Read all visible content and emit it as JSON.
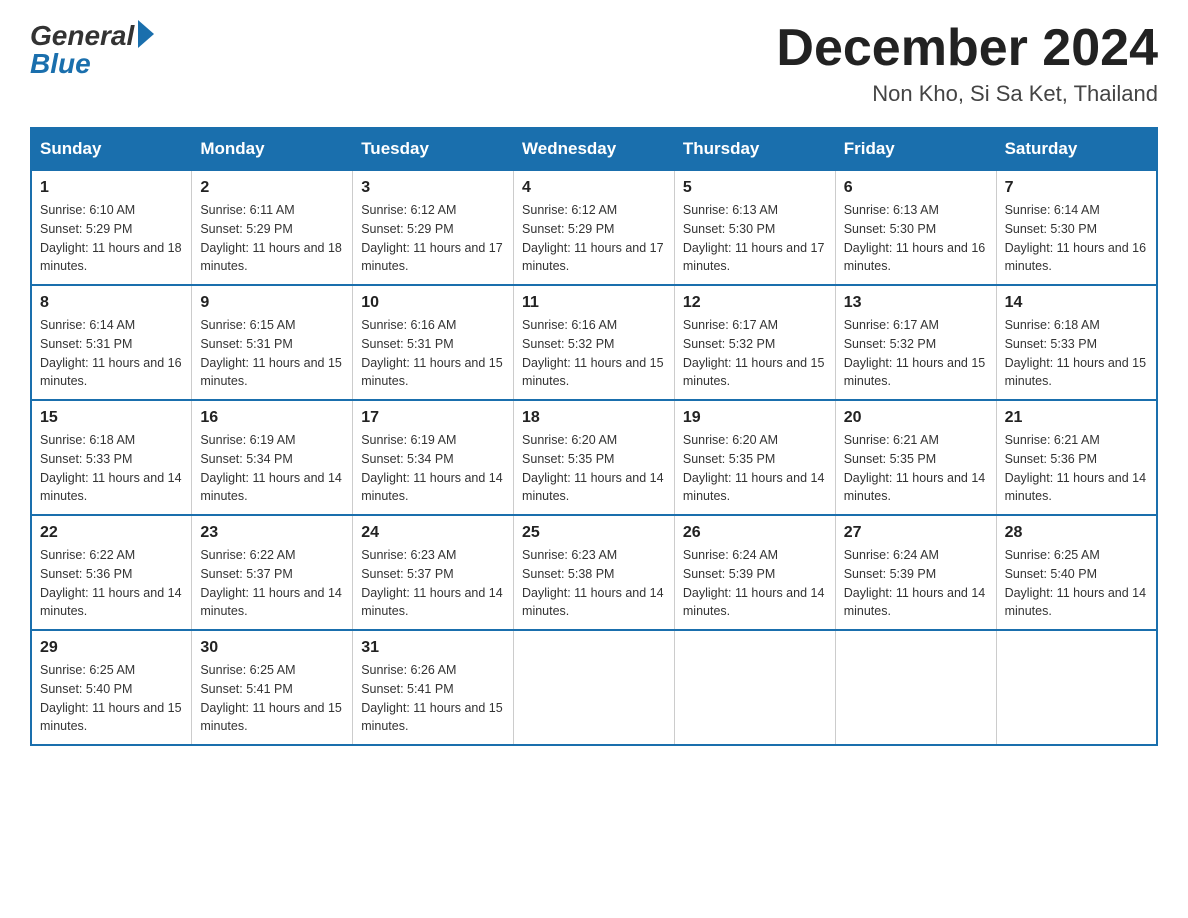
{
  "logo": {
    "general": "General",
    "blue": "Blue"
  },
  "title": "December 2024",
  "location": "Non Kho, Si Sa Ket, Thailand",
  "days_of_week": [
    "Sunday",
    "Monday",
    "Tuesday",
    "Wednesday",
    "Thursday",
    "Friday",
    "Saturday"
  ],
  "weeks": [
    [
      {
        "day": "1",
        "sunrise": "6:10 AM",
        "sunset": "5:29 PM",
        "daylight": "11 hours and 18 minutes."
      },
      {
        "day": "2",
        "sunrise": "6:11 AM",
        "sunset": "5:29 PM",
        "daylight": "11 hours and 18 minutes."
      },
      {
        "day": "3",
        "sunrise": "6:12 AM",
        "sunset": "5:29 PM",
        "daylight": "11 hours and 17 minutes."
      },
      {
        "day": "4",
        "sunrise": "6:12 AM",
        "sunset": "5:29 PM",
        "daylight": "11 hours and 17 minutes."
      },
      {
        "day": "5",
        "sunrise": "6:13 AM",
        "sunset": "5:30 PM",
        "daylight": "11 hours and 17 minutes."
      },
      {
        "day": "6",
        "sunrise": "6:13 AM",
        "sunset": "5:30 PM",
        "daylight": "11 hours and 16 minutes."
      },
      {
        "day": "7",
        "sunrise": "6:14 AM",
        "sunset": "5:30 PM",
        "daylight": "11 hours and 16 minutes."
      }
    ],
    [
      {
        "day": "8",
        "sunrise": "6:14 AM",
        "sunset": "5:31 PM",
        "daylight": "11 hours and 16 minutes."
      },
      {
        "day": "9",
        "sunrise": "6:15 AM",
        "sunset": "5:31 PM",
        "daylight": "11 hours and 15 minutes."
      },
      {
        "day": "10",
        "sunrise": "6:16 AM",
        "sunset": "5:31 PM",
        "daylight": "11 hours and 15 minutes."
      },
      {
        "day": "11",
        "sunrise": "6:16 AM",
        "sunset": "5:32 PM",
        "daylight": "11 hours and 15 minutes."
      },
      {
        "day": "12",
        "sunrise": "6:17 AM",
        "sunset": "5:32 PM",
        "daylight": "11 hours and 15 minutes."
      },
      {
        "day": "13",
        "sunrise": "6:17 AM",
        "sunset": "5:32 PM",
        "daylight": "11 hours and 15 minutes."
      },
      {
        "day": "14",
        "sunrise": "6:18 AM",
        "sunset": "5:33 PM",
        "daylight": "11 hours and 15 minutes."
      }
    ],
    [
      {
        "day": "15",
        "sunrise": "6:18 AM",
        "sunset": "5:33 PM",
        "daylight": "11 hours and 14 minutes."
      },
      {
        "day": "16",
        "sunrise": "6:19 AM",
        "sunset": "5:34 PM",
        "daylight": "11 hours and 14 minutes."
      },
      {
        "day": "17",
        "sunrise": "6:19 AM",
        "sunset": "5:34 PM",
        "daylight": "11 hours and 14 minutes."
      },
      {
        "day": "18",
        "sunrise": "6:20 AM",
        "sunset": "5:35 PM",
        "daylight": "11 hours and 14 minutes."
      },
      {
        "day": "19",
        "sunrise": "6:20 AM",
        "sunset": "5:35 PM",
        "daylight": "11 hours and 14 minutes."
      },
      {
        "day": "20",
        "sunrise": "6:21 AM",
        "sunset": "5:35 PM",
        "daylight": "11 hours and 14 minutes."
      },
      {
        "day": "21",
        "sunrise": "6:21 AM",
        "sunset": "5:36 PM",
        "daylight": "11 hours and 14 minutes."
      }
    ],
    [
      {
        "day": "22",
        "sunrise": "6:22 AM",
        "sunset": "5:36 PM",
        "daylight": "11 hours and 14 minutes."
      },
      {
        "day": "23",
        "sunrise": "6:22 AM",
        "sunset": "5:37 PM",
        "daylight": "11 hours and 14 minutes."
      },
      {
        "day": "24",
        "sunrise": "6:23 AM",
        "sunset": "5:37 PM",
        "daylight": "11 hours and 14 minutes."
      },
      {
        "day": "25",
        "sunrise": "6:23 AM",
        "sunset": "5:38 PM",
        "daylight": "11 hours and 14 minutes."
      },
      {
        "day": "26",
        "sunrise": "6:24 AM",
        "sunset": "5:39 PM",
        "daylight": "11 hours and 14 minutes."
      },
      {
        "day": "27",
        "sunrise": "6:24 AM",
        "sunset": "5:39 PM",
        "daylight": "11 hours and 14 minutes."
      },
      {
        "day": "28",
        "sunrise": "6:25 AM",
        "sunset": "5:40 PM",
        "daylight": "11 hours and 14 minutes."
      }
    ],
    [
      {
        "day": "29",
        "sunrise": "6:25 AM",
        "sunset": "5:40 PM",
        "daylight": "11 hours and 15 minutes."
      },
      {
        "day": "30",
        "sunrise": "6:25 AM",
        "sunset": "5:41 PM",
        "daylight": "11 hours and 15 minutes."
      },
      {
        "day": "31",
        "sunrise": "6:26 AM",
        "sunset": "5:41 PM",
        "daylight": "11 hours and 15 minutes."
      },
      null,
      null,
      null,
      null
    ]
  ]
}
